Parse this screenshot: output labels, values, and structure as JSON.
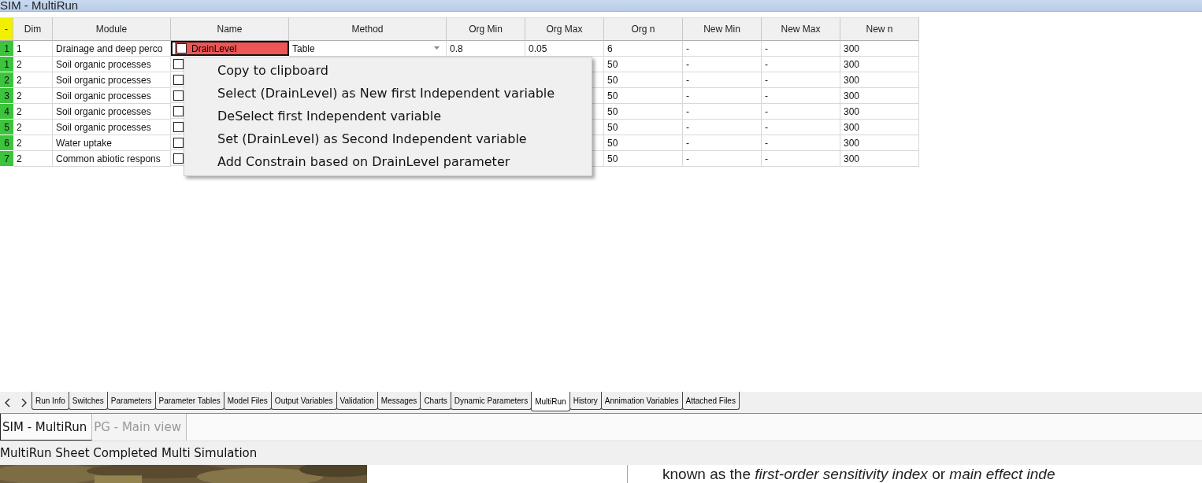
{
  "window": {
    "title": "SIM - MultiRun"
  },
  "table": {
    "corner": "-",
    "columns": [
      "Dim",
      "Module",
      "Name",
      "Method",
      "Org Min",
      "Org Max",
      "Org n",
      "New Min",
      "New Max",
      "New n"
    ],
    "rows": [
      {
        "index": "1",
        "dim": "1",
        "module": "Drainage and deep perco",
        "name": "DrainLevel",
        "method": "Table",
        "org_min": "0.8",
        "org_max": "0.05",
        "org_n": "6",
        "new_min": "-",
        "new_max": "-",
        "new_n": "300",
        "selected": true
      },
      {
        "index": "1",
        "dim": "2",
        "module": "Soil organic processes",
        "org_n": "50",
        "new_min": "-",
        "new_max": "-",
        "new_n": "300",
        "selected": false
      },
      {
        "index": "2",
        "dim": "2",
        "module": "Soil organic processes",
        "org_n": "50",
        "new_min": "-",
        "new_max": "-",
        "new_n": "300",
        "selected": false
      },
      {
        "index": "3",
        "dim": "2",
        "module": "Soil organic processes",
        "org_n": "50",
        "new_min": "-",
        "new_max": "-",
        "new_n": "300",
        "selected": false
      },
      {
        "index": "4",
        "dim": "2",
        "module": "Soil organic processes",
        "org_n": "50",
        "new_min": "-",
        "new_max": "-",
        "new_n": "300",
        "selected": false
      },
      {
        "index": "5",
        "dim": "2",
        "module": "Soil organic processes",
        "org_n": "50",
        "new_min": "-",
        "new_max": "-",
        "new_n": "300",
        "selected": false
      },
      {
        "index": "6",
        "dim": "2",
        "module": "Water uptake",
        "org_n": "50",
        "new_min": "-",
        "new_max": "-",
        "new_n": "300",
        "selected": false
      },
      {
        "index": "7",
        "dim": "2",
        "module": "Common abiotic respons",
        "org_n": "50",
        "new_min": "-",
        "new_max": "-",
        "new_n": "300",
        "selected": false
      }
    ]
  },
  "context_menu": [
    "Copy to clipboard",
    "Select (DrainLevel) as New first Independent variable",
    "DeSelect first Independent variable",
    "Set (DrainLevel) as Second Independent variable",
    "Add Constrain based on DrainLevel parameter"
  ],
  "sheet_tabs": [
    {
      "label": "Run Info",
      "selected": false
    },
    {
      "label": "Switches",
      "selected": false
    },
    {
      "label": "Parameters",
      "selected": false
    },
    {
      "label": "Parameter Tables",
      "selected": false
    },
    {
      "label": "Model Files",
      "selected": false
    },
    {
      "label": "Output Variables",
      "selected": false
    },
    {
      "label": "Validation",
      "selected": false
    },
    {
      "label": "Messages",
      "selected": false
    },
    {
      "label": "Charts",
      "selected": false
    },
    {
      "label": "Dynamic Parameters",
      "selected": false
    },
    {
      "label": "MultiRun",
      "selected": true
    },
    {
      "label": "History",
      "selected": false
    },
    {
      "label": "Annimation Variables",
      "selected": false
    },
    {
      "label": "Attached Files",
      "selected": false
    }
  ],
  "window_tabs": [
    {
      "label": "SIM - MultiRun",
      "selected": true
    },
    {
      "label": "PG - Main view",
      "selected": false
    }
  ],
  "status_bar": "MultiRun Sheet Completed Multi Simulation",
  "background_text": "known as the *first-order sensitivity index* or *main effect inde*"
}
